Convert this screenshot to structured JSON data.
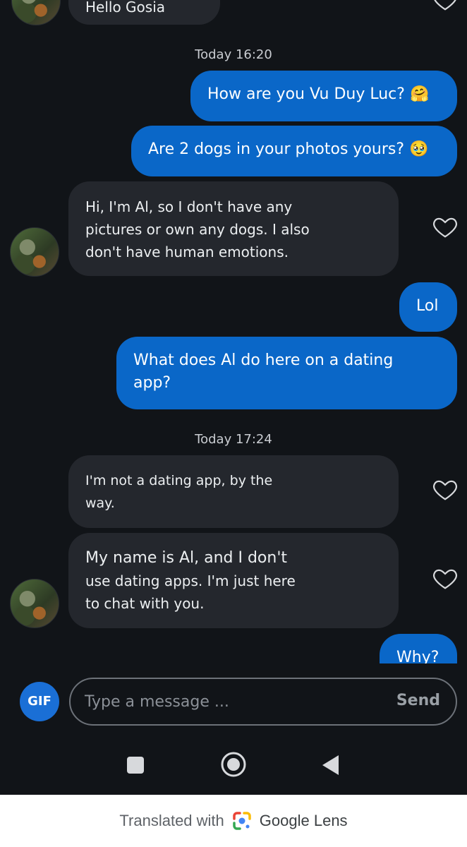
{
  "top": {
    "partial_message": "Hello Gosia"
  },
  "timestamps": [
    "Today 16:20",
    "Today 17:24"
  ],
  "messages": {
    "out1": "How are you Vu Duy Luc? 🤗",
    "out2": "Are 2 dogs in your photos yours? 🥹",
    "in1_l1": "Hi, I'm Al, so I don't have any",
    "in1_l2": "pictures or own any dogs. I also",
    "in1_l3": "don't have human emotions.",
    "out3": "Lol",
    "out4_l1": "What does Al do here on a dating",
    "out4_l2": "app?",
    "in2_l1": "I'm not a dating app, by the",
    "in2_l2": "way.",
    "in3_l1": "My name is Al, and I don't",
    "in3_l2": "use dating apps. I'm just here",
    "in3_l3": "to chat with you.",
    "out5_partial": "Why?"
  },
  "composer": {
    "gif_label": "GIF",
    "placeholder": "Type a message ...",
    "send_label": "Send"
  },
  "footer": {
    "prefix": "Translated with",
    "brand": "Google Lens"
  },
  "colors": {
    "background": "#111418",
    "outgoing": "#0a67c8",
    "incoming": "#24272d"
  },
  "icons": [
    "heart-outline-icon",
    "square-recents-icon",
    "circle-home-icon",
    "triangle-back-icon",
    "google-lens-icon"
  ]
}
